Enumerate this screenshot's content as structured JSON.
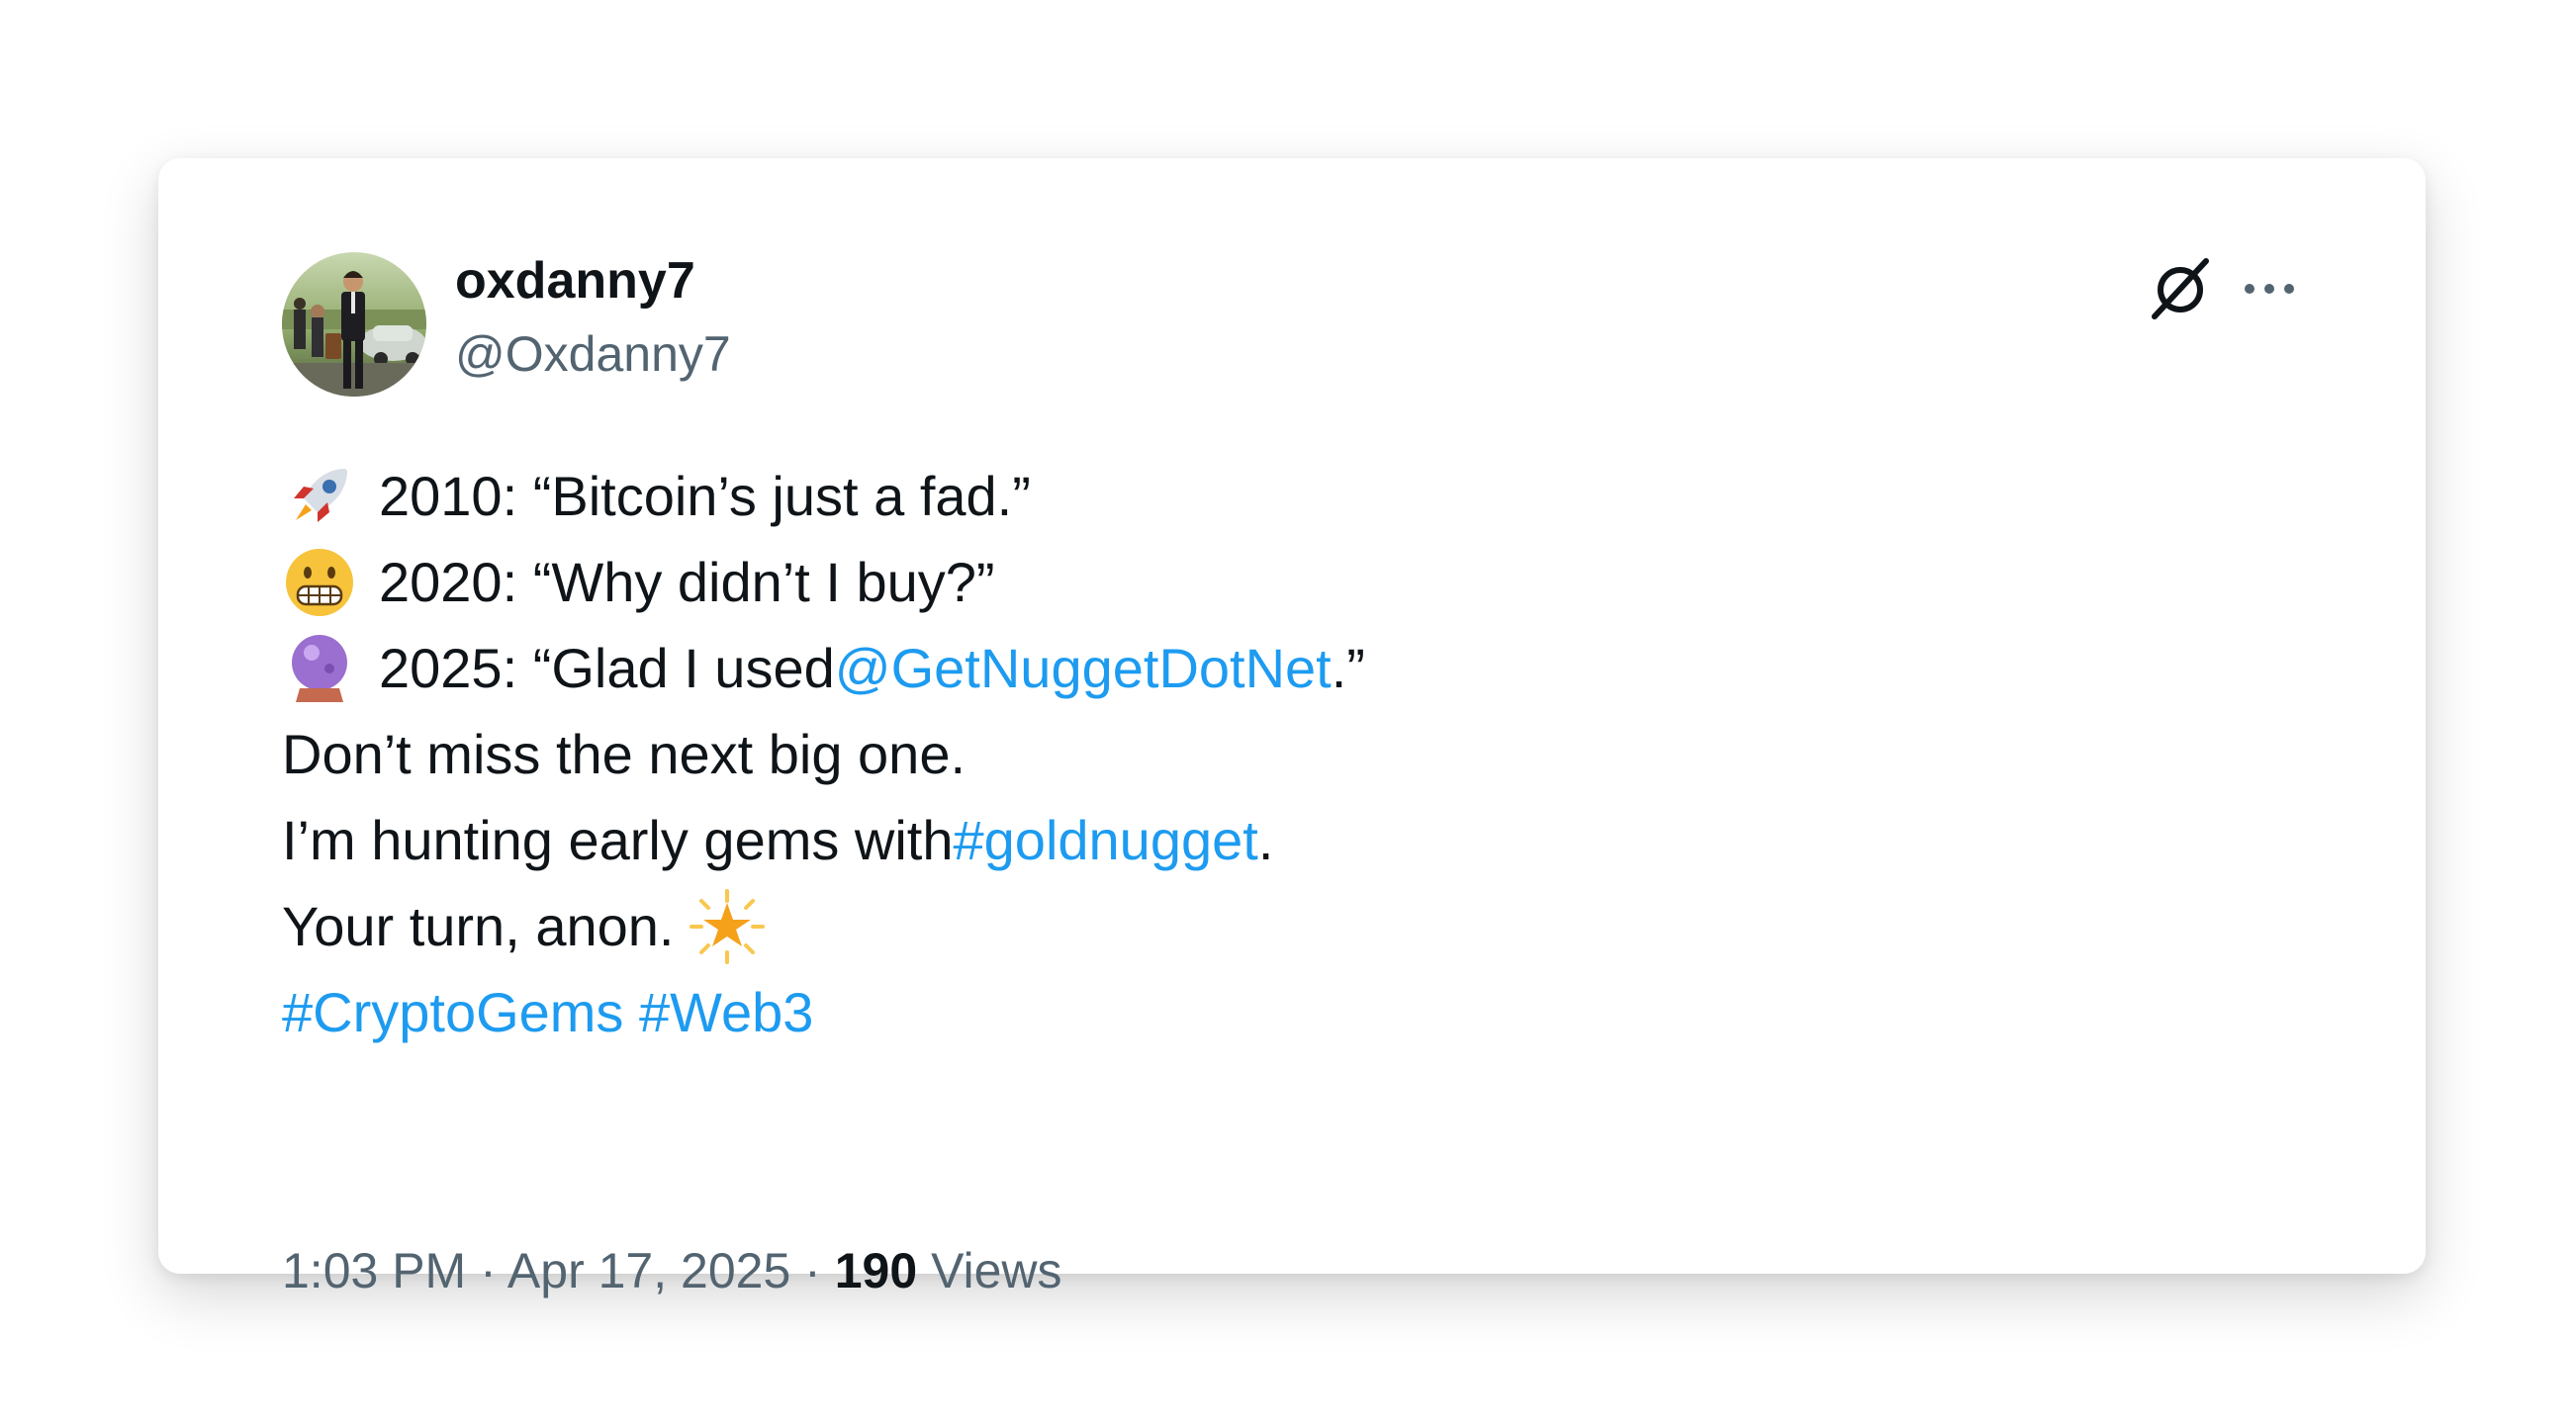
{
  "tweet": {
    "display_name": "oxdanny7",
    "handle": "@Oxdanny7",
    "avatar_icon": "avatar-photo",
    "header_icons": [
      "x-logo-icon",
      "more-options-icon"
    ],
    "lines": [
      {
        "emoji": "rocket-emoji",
        "text": "2010: “Bitcoin’s just a fad.”"
      },
      {
        "emoji": "grimacing-face-emoji",
        "text": "2020: “Why didn’t I buy?”"
      },
      {
        "emoji": "crystal-ball-emoji",
        "text_before": "2025: “Glad I used ",
        "mention": "@GetNuggetDotNet",
        "text_after": ".”"
      },
      {
        "text": "Don’t miss the next big one."
      },
      {
        "text_before": "I’m hunting early gems with ",
        "hashtag": "#goldnugget",
        "text_after": "."
      },
      {
        "text": "Your turn, anon.",
        "emoji": "glowing-star-emoji"
      },
      {
        "hashtag_1": "#CryptoGems",
        "hashtag_2": "#Web3"
      }
    ],
    "link_color": "#1d9bf0",
    "time": "1:03 PM",
    "separator": "·",
    "date": "Apr 17, 2025",
    "views_count": "190",
    "views_label": "Views"
  }
}
